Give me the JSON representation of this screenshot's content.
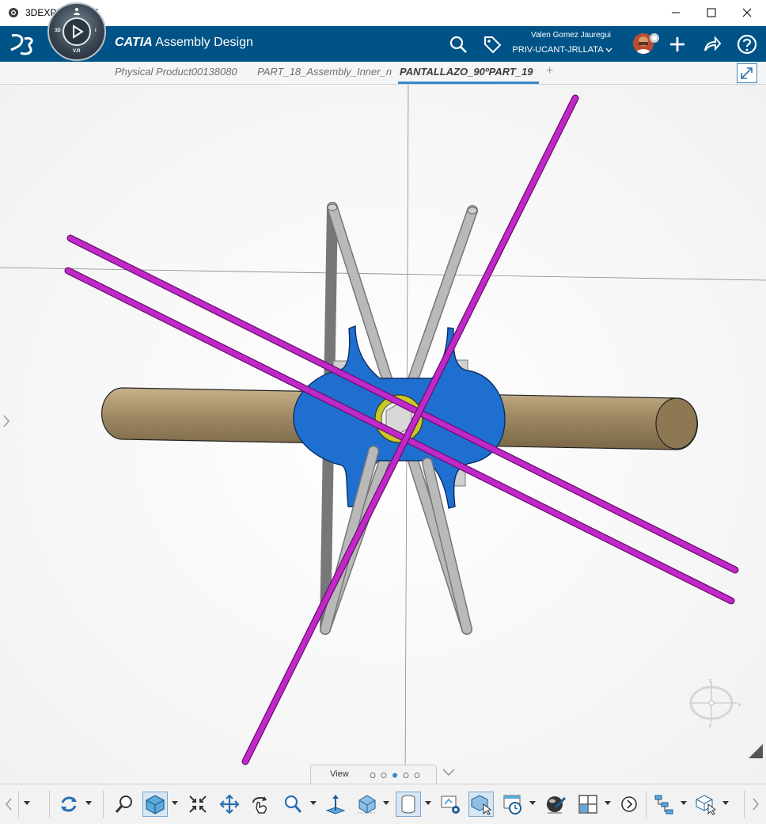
{
  "window": {
    "title": "3DEXPERIENCE"
  },
  "header": {
    "brand_bold": "CATIA",
    "brand_rest": "Assembly Design",
    "compass": {
      "label_3d": "3D",
      "label_vr": "V.R",
      "label_i": "i"
    },
    "user": {
      "name": "Valen Gomez Jauregui",
      "tenant": "PRIV-UCANT-JRLLATA"
    }
  },
  "tabs": [
    {
      "label": "Physical Product00138080"
    },
    {
      "label": "PART_18_Assembly_Inner_n"
    },
    {
      "label": "PANTALLAZO_90ºPART_19"
    }
  ],
  "tab_add": "+",
  "view_panel": {
    "label": "View",
    "pages": 5,
    "active_page": 3
  },
  "compass_axes": {
    "x": "x",
    "y": "y",
    "z": "z"
  },
  "colors": {
    "header": "#005386",
    "rod_tan": "#a08a64",
    "hub_blue": "#1f6fd0",
    "ring_yellow": "#c8c82a",
    "magenta": "#c028c8",
    "gray_rod": "#aaaaaa"
  }
}
